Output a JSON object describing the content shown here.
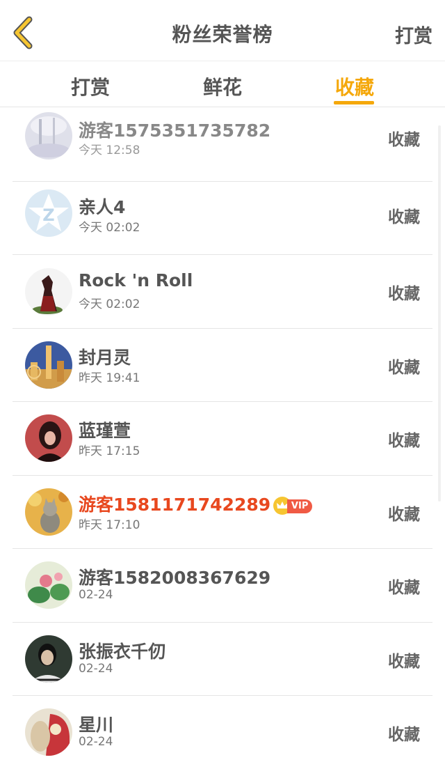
{
  "header": {
    "title": "粉丝荣誉榜",
    "action_label": "打赏",
    "back_icon": "chevron-left-icon",
    "accent_color": "#f5a80b"
  },
  "tabs": [
    {
      "label": "打赏",
      "active": false
    },
    {
      "label": "鲜花",
      "active": false
    },
    {
      "label": "收藏",
      "active": true
    }
  ],
  "fans": [
    {
      "name": "游客1575351735782",
      "time": "今天 12:58",
      "action": "收藏",
      "vip": false
    },
    {
      "name": "亲人4",
      "time": "今天 02:02",
      "action": "收藏",
      "vip": false
    },
    {
      "name": "Rock 'n Roll",
      "time": "今天 02:02",
      "action": "收藏",
      "vip": false
    },
    {
      "name": "封月灵",
      "time": "昨天 19:41",
      "action": "收藏",
      "vip": false
    },
    {
      "name": "蓝瑾萱",
      "time": "昨天 17:15",
      "action": "收藏",
      "vip": false
    },
    {
      "name": "游客1581171742289",
      "time": "昨天 17:10",
      "action": "收藏",
      "vip": true,
      "vip_label": "VIP"
    },
    {
      "name": "游客1582008367629",
      "time": "02-24",
      "action": "收藏",
      "vip": false
    },
    {
      "name": "张振衣千仞",
      "time": "02-24",
      "action": "收藏",
      "vip": false
    },
    {
      "name": "星川",
      "time": "02-24",
      "action": "收藏",
      "vip": false
    }
  ]
}
